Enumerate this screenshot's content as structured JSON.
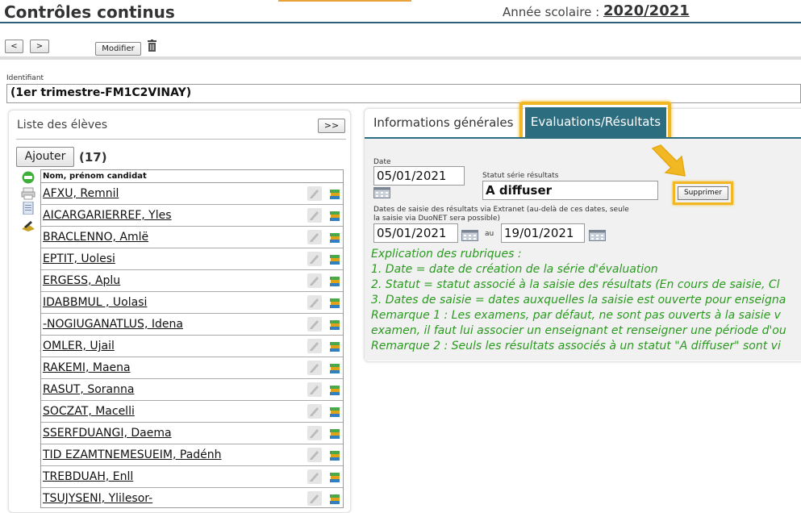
{
  "header": {
    "title": "Contrôles continus",
    "year_label": "Année scolaire :",
    "year_value": "2020/2021"
  },
  "toolbar": {
    "prev_label": "<",
    "next_label": ">",
    "modify_label": "Modifier",
    "delete_icon": "trash-icon"
  },
  "identifier": {
    "label": "Identifiant",
    "value": "(1er trimestre-FM1C2VINAY)"
  },
  "students": {
    "title": "Liste des élèves",
    "expand_label": ">>",
    "add_label": "Ajouter",
    "count": "(17)",
    "column_header": "Nom, prénom candidat",
    "side_icons": [
      "message-icon",
      "print-icon",
      "document-icon",
      "export-icon"
    ],
    "rows": [
      "AFXU, Remnil",
      "AICARGARIERREF, Yles",
      "BRACLENNO, Amlë",
      "EPTIT, Uolesi",
      "ERGESS, Aplu",
      "IDABBMUL , Uolasi",
      "-NOGIUGANATLUS, Idena",
      "OMLER, Ujail",
      "RAKEMI, Maena",
      "RASUT, Soranna",
      "SOCZAT, Macelli",
      "SSERFDUANGI, Daema",
      "TID EZAMTNEMESUEIM, Padénh",
      "TREBDUAH, Enll",
      "TSUJYSENI, Ylilesor-"
    ]
  },
  "tabs": {
    "info": "Informations générales",
    "eval": "Evaluations/Résultats"
  },
  "form": {
    "date_label": "Date",
    "date_value": "05/01/2021",
    "status_label": "Statut série résultats",
    "status_value": "A diffuser",
    "delete_label": "Supprimer",
    "dates_desc_line1": "Dates de saisie des résultats via Extranet (au-delà de ces dates, seule",
    "dates_desc_line2": "la saisie via DuoNET sera possible)",
    "date_from": "05/01/2021",
    "au_label": "au",
    "date_to": "19/01/2021"
  },
  "explanation": {
    "lines": [
      "Explication des rubriques :",
      "1. Date = date de création de la série d'évaluation",
      "2. Statut = statut associé à la saisie des résultats (En cours de saisie, Cl",
      "3. Dates de saisie = dates auxquelles la saisie est ouverte pour enseigna",
      "Remarque 1 : Les examens, par défaut, ne sont pas ouverts à la saisie v",
      "examen, il faut lui associer un enseignant et renseigner une période d'ou",
      "Remarque 2 : Seuls les résultats associés à un statut \"A diffuser\" sont vi"
    ]
  },
  "colors": {
    "accent": "#2d6d80",
    "highlight": "#f2b824",
    "note_green": "#2a9a1f"
  }
}
